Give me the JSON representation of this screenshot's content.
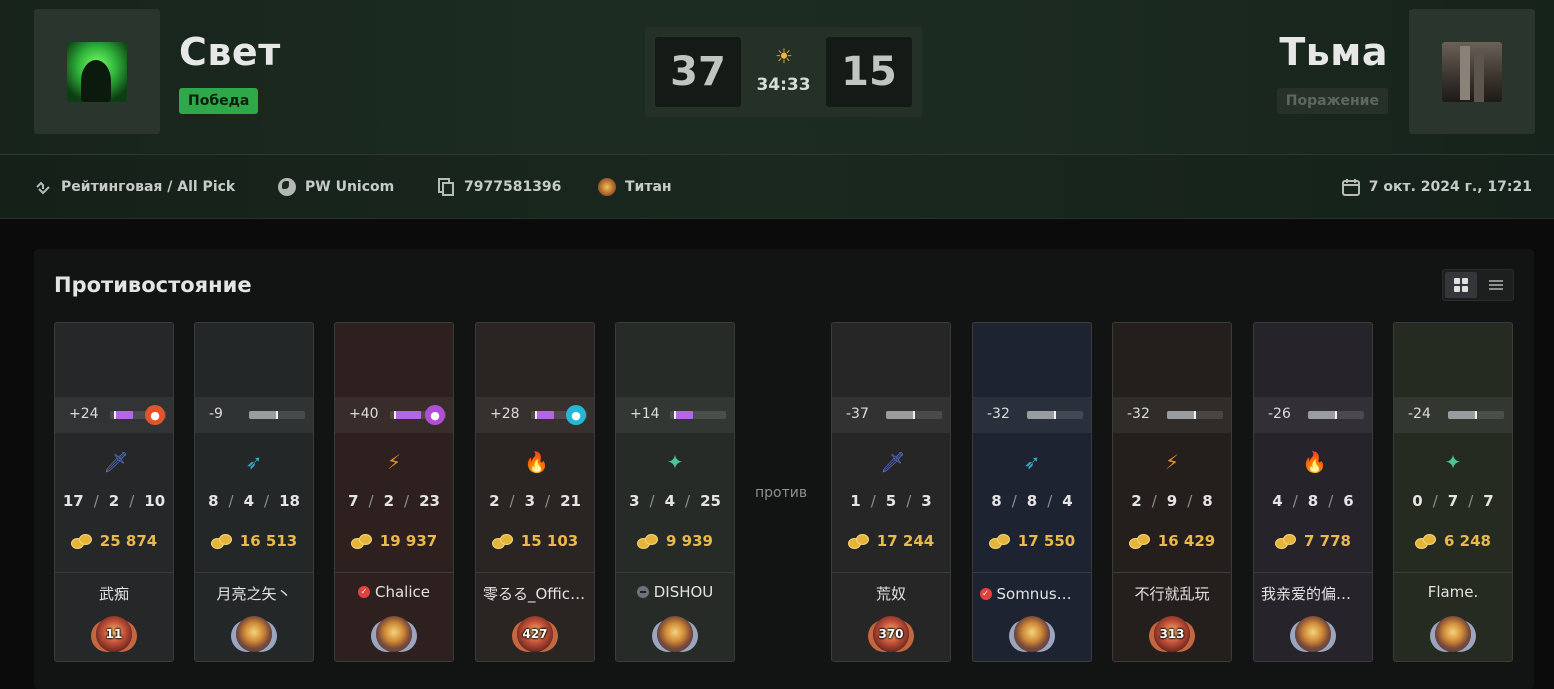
{
  "match": {
    "radiant": {
      "name": "Свет",
      "result": "Победа",
      "score": "37"
    },
    "dire": {
      "name": "Тьма",
      "result": "Поражение",
      "score": "15"
    },
    "duration": "34:33"
  },
  "info": {
    "mode": "Рейтинговая / All Pick",
    "region": "PW Unicom",
    "match_id": "7977581396",
    "rank": "Титан",
    "date": "7 окт. 2024 г., 17:21"
  },
  "panel": {
    "title": "Противостояние",
    "vs": "против"
  },
  "colors": {
    "accent_win": "#2fa84a",
    "gold": "#e9b94a",
    "facet_purple": "#b466e6"
  },
  "players": [
    {
      "name": "武痴",
      "net_change": "+24",
      "net_level": 0.3,
      "facet": "orange-claw-icon",
      "facet_color": "#e2552a",
      "role": "sword-icon",
      "role_color": "#5a79e6",
      "kills": "17",
      "deaths": "2",
      "assists": "10",
      "networth": "25 874",
      "rank_number": "11",
      "medal": "immortal",
      "badge": "",
      "bg": "#262728"
    },
    {
      "name": "月亮之矢丶",
      "net_change": "-9",
      "net_level": 0.1,
      "facet": "",
      "facet_color": "",
      "role": "bow-icon",
      "role_color": "#3ca7c5",
      "kills": "8",
      "deaths": "4",
      "assists": "18",
      "networth": "16 513",
      "rank_number": "",
      "medal": "divine",
      "badge": "",
      "bg": "#232728"
    },
    {
      "name": "Chalice",
      "net_change": "+40",
      "net_level": 0.45,
      "facet": "purple-crown-icon",
      "facet_color": "#b04fd6",
      "role": "lightning-shield-icon",
      "role_color": "#e28a2b",
      "kills": "7",
      "deaths": "2",
      "assists": "23",
      "networth": "19 937",
      "rank_number": "",
      "medal": "divine",
      "badge": "verified",
      "bg": "#2d201e"
    },
    {
      "name": "零るる_Official",
      "net_change": "+28",
      "net_level": 0.3,
      "facet": "cyan-star-icon",
      "facet_color": "#25b8d6",
      "role": "flame-hand-icon",
      "role_color": "#d8573a",
      "kills": "2",
      "deaths": "3",
      "assists": "21",
      "networth": "15 103",
      "rank_number": "427",
      "medal": "immortal",
      "badge": "",
      "bg": "#2a2422"
    },
    {
      "name": "DISHOU",
      "net_change": "+14",
      "net_level": 0.3,
      "facet": "",
      "facet_color": "",
      "role": "sparkle-hand-icon",
      "role_color": "#4fc39b",
      "kills": "3",
      "deaths": "4",
      "assists": "25",
      "networth": "9 939",
      "rank_number": "",
      "medal": "divine",
      "badge": "plus",
      "bg": "#262b28"
    },
    {
      "name": "荒奴",
      "net_change": "-37",
      "net_level": 0.1,
      "facet": "",
      "facet_color": "",
      "role": "sword-icon",
      "role_color": "#5a79e6",
      "kills": "1",
      "deaths": "5",
      "assists": "3",
      "networth": "17 244",
      "rank_number": "370",
      "medal": "immortal",
      "badge": "",
      "bg": "#272626"
    },
    {
      "name": "Somnus丶M",
      "net_change": "-32",
      "net_level": 0.1,
      "facet": "",
      "facet_color": "",
      "role": "bow-icon",
      "role_color": "#3ca7c5",
      "kills": "8",
      "deaths": "8",
      "assists": "4",
      "networth": "17 550",
      "rank_number": "",
      "medal": "divine",
      "badge": "verified",
      "bg": "#1d2330"
    },
    {
      "name": "不行就乱玩",
      "net_change": "-32",
      "net_level": 0.1,
      "facet": "",
      "facet_color": "",
      "role": "lightning-shield-icon",
      "role_color": "#e28a2b",
      "kills": "2",
      "deaths": "9",
      "assists": "8",
      "networth": "16 429",
      "rank_number": "313",
      "medal": "immortal",
      "badge": "",
      "bg": "#241f1c"
    },
    {
      "name": "我亲爱的偏执狂",
      "net_change": "-26",
      "net_level": 0.1,
      "facet": "",
      "facet_color": "",
      "role": "flame-hand-icon",
      "role_color": "#d8573a",
      "kills": "4",
      "deaths": "8",
      "assists": "6",
      "networth": "7 778",
      "rank_number": "",
      "medal": "divine",
      "badge": "",
      "bg": "#27232a"
    },
    {
      "name": "Flame.",
      "net_change": "-24",
      "net_level": 0.1,
      "facet": "",
      "facet_color": "",
      "role": "sparkle-hand-icon",
      "role_color": "#4fc39b",
      "kills": "0",
      "deaths": "7",
      "assists": "7",
      "networth": "6 248",
      "rank_number": "",
      "medal": "divine",
      "badge": "",
      "bg": "#262b22"
    }
  ]
}
